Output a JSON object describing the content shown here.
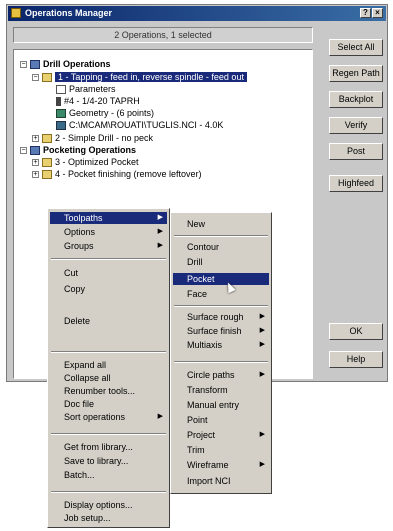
{
  "window": {
    "title": "Operations Manager",
    "status": "2 Operations, 1 selected",
    "min_glyph": "?",
    "close_glyph": "×"
  },
  "tree": {
    "drill_group": "Drill Operations",
    "op1": "1 - Tapping - feed in, reverse spindle - feed out",
    "parameters": "Parameters",
    "tool": "#4 - 1/4-20 TAPRH",
    "geometry": "Geometry - (6 points)",
    "nc": "C:\\MCAM\\ROUATI\\TUGLIS.NCI - 4.0K",
    "op2": "2 - Simple Drill - no peck",
    "pocket_group": "Pocketing Operations",
    "op3": "3 - Optimized Pocket",
    "op4": "4 - Pocket finishing (remove leftover)"
  },
  "buttons": {
    "select_all": "Select All",
    "regen_path": "Regen Path",
    "backplot": "Backplot",
    "verify": "Verify",
    "post": "Post",
    "highfeed": "Highfeed",
    "ok": "OK",
    "help": "Help"
  },
  "context_menu": {
    "toolpaths": "Toolpaths",
    "options": "Options",
    "groups": "Groups",
    "cut": "Cut",
    "copy": "Copy",
    "delete": "Delete",
    "expand_all": "Expand all",
    "collapse_all": "Collapse all",
    "renumber_tools": "Renumber tools...",
    "doc_file": "Doc file",
    "sort_operations": "Sort operations",
    "get_from_library": "Get from library...",
    "save_to_library": "Save to library...",
    "batch": "Batch...",
    "display_options": "Display options...",
    "job_setup": "Job setup..."
  },
  "submenu": {
    "new": "New",
    "contour": "Contour",
    "drill": "Drill",
    "pocket": "Pocket",
    "face": "Face",
    "surface_rough": "Surface rough",
    "surface_finish": "Surface finish",
    "multiaxis": "Multiaxis",
    "circle_paths": "Circle paths",
    "transform": "Transform",
    "manual_entry": "Manual entry",
    "point": "Point",
    "project": "Project",
    "trim": "Trim",
    "wireframe": "Wireframe",
    "import_nci": "Import NCI"
  },
  "colors": {
    "title_bar": "#0a246a",
    "selection": "#1a2a7a",
    "face": "#d4d0c8"
  }
}
